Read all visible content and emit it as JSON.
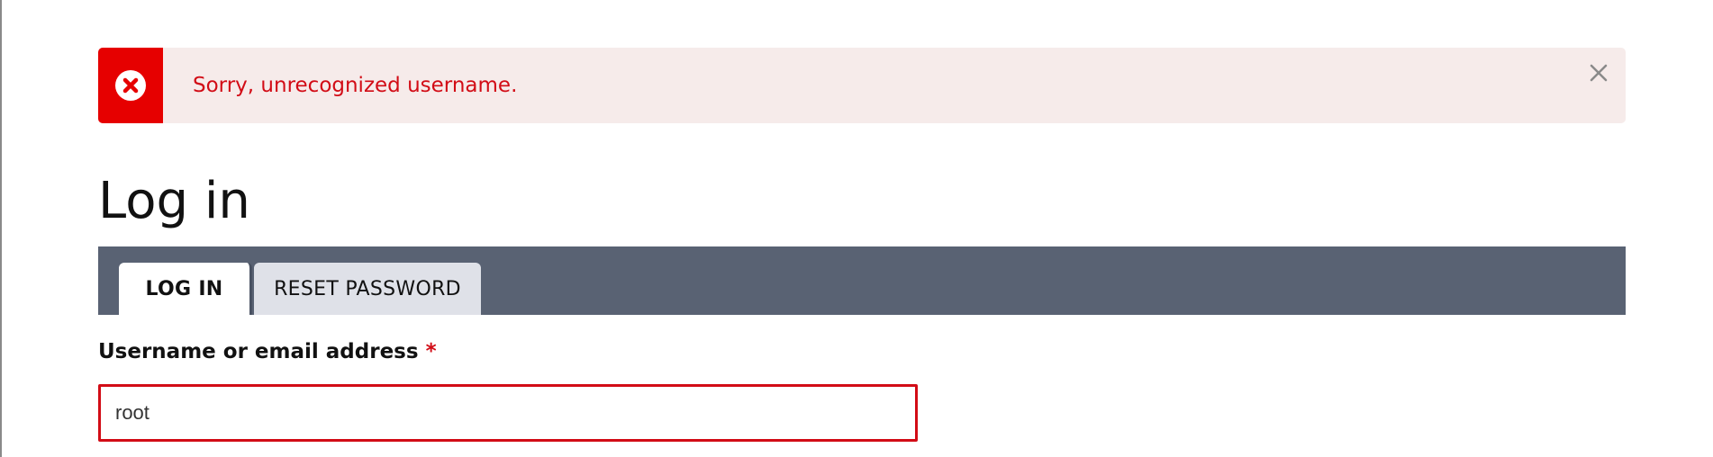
{
  "message": {
    "type": "error",
    "text": "Sorry, unrecognized username.",
    "icon": "error-x-icon",
    "close_icon": "close-icon",
    "colors": {
      "background": "#f6ebea",
      "accent": "#e60000",
      "text": "#d20c16"
    }
  },
  "page": {
    "title": "Log in"
  },
  "tabs": [
    {
      "label": "LOG IN",
      "active": true
    },
    {
      "label": "RESET PASSWORD",
      "active": false
    }
  ],
  "form": {
    "username": {
      "label": "Username or email address",
      "required_marker": "*",
      "value": "root",
      "state": "error"
    }
  },
  "colors": {
    "tabbar": "#596273",
    "error": "#d20c16"
  }
}
